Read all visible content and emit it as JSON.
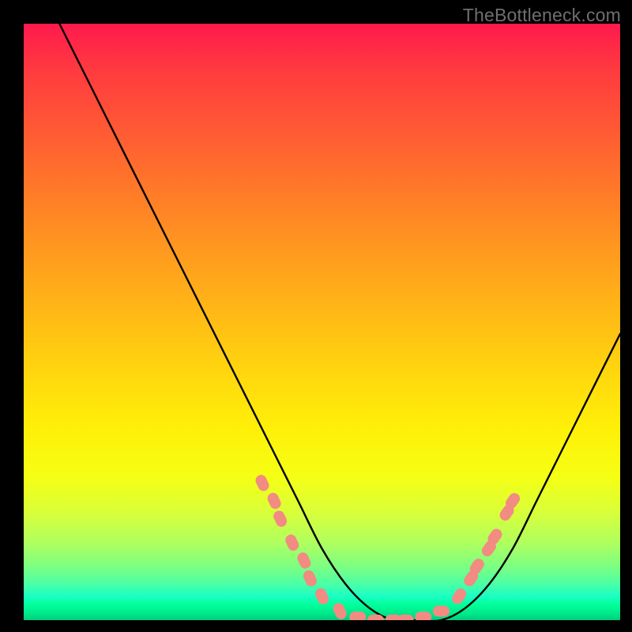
{
  "watermark": {
    "text": "TheBottleneck.com"
  },
  "chart_data": {
    "type": "line",
    "title": "",
    "xlabel": "",
    "ylabel": "",
    "xlim": [
      0,
      100
    ],
    "ylim": [
      0,
      100
    ],
    "grid": false,
    "legend": false,
    "series": [
      {
        "name": "bottleneck-curve",
        "color": "#000000",
        "x": [
          6,
          10,
          14,
          18,
          22,
          26,
          30,
          34,
          38,
          42,
          46,
          50,
          54,
          58,
          62,
          66,
          70,
          74,
          78,
          82,
          86,
          90,
          94,
          98,
          100
        ],
        "y": [
          100,
          92,
          84,
          76,
          68,
          60,
          52,
          44,
          36,
          28,
          20,
          12,
          6,
          2,
          0,
          0,
          0,
          2,
          6,
          12,
          20,
          28,
          36,
          44,
          48
        ]
      }
    ],
    "markers": {
      "name": "data-point-dots",
      "color": "#f28b82",
      "radius": 7,
      "points": [
        {
          "x": 40,
          "y": 23
        },
        {
          "x": 42,
          "y": 20
        },
        {
          "x": 43,
          "y": 17
        },
        {
          "x": 45,
          "y": 13
        },
        {
          "x": 47,
          "y": 10
        },
        {
          "x": 48,
          "y": 7
        },
        {
          "x": 50,
          "y": 4
        },
        {
          "x": 53,
          "y": 1.5
        },
        {
          "x": 56,
          "y": 0.5
        },
        {
          "x": 59,
          "y": 0
        },
        {
          "x": 62,
          "y": 0
        },
        {
          "x": 64,
          "y": 0
        },
        {
          "x": 67,
          "y": 0.5
        },
        {
          "x": 70,
          "y": 1.5
        },
        {
          "x": 73,
          "y": 4
        },
        {
          "x": 75,
          "y": 7
        },
        {
          "x": 76,
          "y": 9
        },
        {
          "x": 78,
          "y": 12
        },
        {
          "x": 79,
          "y": 14
        },
        {
          "x": 81,
          "y": 18
        },
        {
          "x": 82,
          "y": 20
        }
      ]
    },
    "background_gradient": {
      "top": "#ff1a4d",
      "mid": "#fff008",
      "bottom": "#00cc7a"
    }
  }
}
